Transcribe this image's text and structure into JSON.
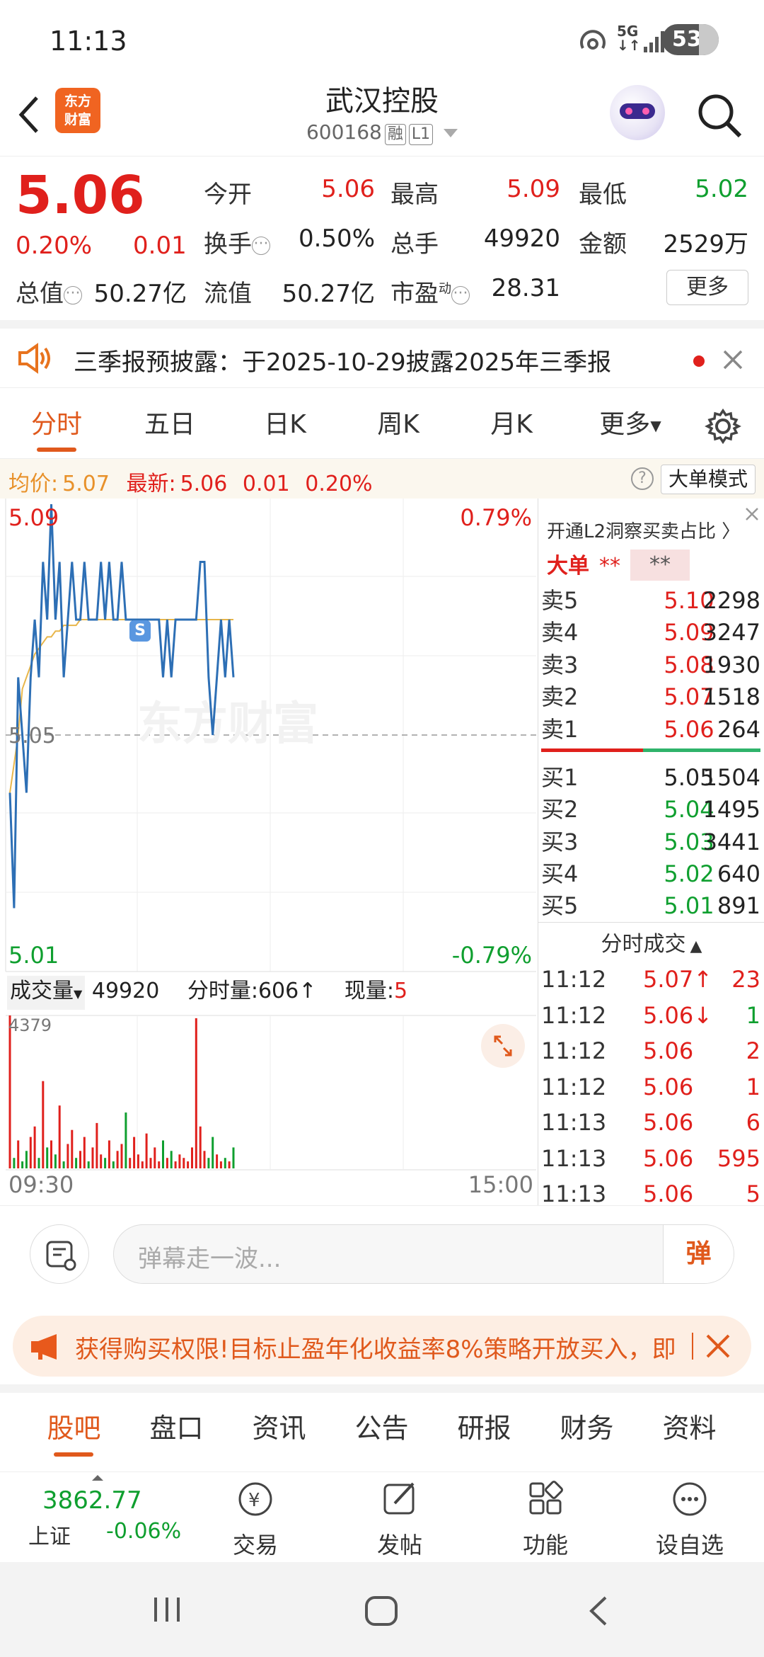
{
  "status": {
    "time": "11:13",
    "net": "5G",
    "battery": "53"
  },
  "header": {
    "title": "武汉控股",
    "code": "600168",
    "tag_margin": "融",
    "tag_level": "L1",
    "logo_line1": "东方",
    "logo_line2": "财富"
  },
  "quote": {
    "price": "5.06",
    "change_pct": "0.20%",
    "change": "0.01",
    "open_label": "今开",
    "open": "5.06",
    "high_label": "最高",
    "high": "5.09",
    "low_label": "最低",
    "low": "5.02",
    "turnover_label": "换手",
    "turnover": "0.50%",
    "volume_label": "总手",
    "volume": "49920",
    "amount_label": "金额",
    "amount": "2529万",
    "mktcap_label": "总值",
    "mktcap": "50.27亿",
    "float_label": "流值",
    "float": "50.27亿",
    "pe_label": "市盈",
    "pe_sup": "动",
    "pe": "28.31",
    "more": "更多"
  },
  "notice": {
    "text": "三季报预披露：于2025-10-29披露2025年三季报"
  },
  "tabs": [
    "分时",
    "五日",
    "日K",
    "周K",
    "月K",
    "更多"
  ],
  "infobar": {
    "avg_label": "均价:",
    "avg": "5.07",
    "last_label": "最新:",
    "last": "5.06",
    "chg": "0.01",
    "pct": "0.20%",
    "mode": "大单模式"
  },
  "chart": {
    "ymax": "5.09",
    "ymin": "5.01",
    "ymid": "5.05",
    "pmax": "0.79%",
    "pmin": "-0.79%",
    "watermark": "东方财富",
    "vol_label": "成交量",
    "vol_value": "49920",
    "fs_label": "分时量:606↑",
    "now_label": "现量:",
    "now_value": "5",
    "vol_max": "4379",
    "t_start": "09:30",
    "t_end": "15:00",
    "s_badge": "S"
  },
  "chart_data": {
    "type": "line",
    "ylim": [
      5.01,
      5.09
    ],
    "series": [
      {
        "name": "",
        "values": [
          5.04,
          5.02,
          5.06,
          5.05,
          5.04,
          5.06,
          5.07,
          5.06,
          5.08,
          5.07,
          5.09,
          5.07,
          5.08,
          5.06,
          5.07,
          5.08,
          5.07,
          5.07,
          5.08,
          5.07,
          5.07,
          5.07,
          5.08,
          5.07,
          5.08,
          5.07,
          5.07,
          5.08,
          5.07,
          5.07,
          5.07,
          5.07,
          5.07,
          5.07,
          5.07,
          5.07,
          5.07,
          5.06,
          5.07,
          5.06,
          5.07,
          5.07,
          5.07,
          5.07,
          5.07,
          5.07,
          5.08,
          5.08,
          5.06,
          5.05,
          5.06,
          5.07,
          5.06,
          5.07,
          5.06
        ]
      },
      {
        "name": "均价",
        "values": [
          5.04,
          5.045,
          5.05,
          5.058,
          5.06,
          5.062,
          5.064,
          5.065,
          5.066,
          5.067,
          5.067,
          5.068,
          5.068,
          5.069,
          5.069,
          5.069,
          5.069,
          5.07,
          5.07,
          5.07,
          5.07,
          5.07,
          5.07,
          5.07,
          5.07,
          5.07,
          5.07,
          5.07,
          5.07,
          5.07,
          5.07,
          5.07,
          5.07,
          5.07,
          5.07,
          5.07,
          5.07,
          5.07,
          5.07,
          5.07,
          5.07,
          5.07,
          5.07,
          5.07,
          5.07,
          5.07,
          5.07,
          5.07,
          5.07,
          5.07,
          5.07,
          5.07,
          5.07,
          5.07,
          5.07
        ]
      }
    ],
    "volume": [
      4379,
      300,
      800,
      200,
      500,
      900,
      1200,
      300,
      2500,
      600,
      800,
      400,
      1800,
      200,
      700,
      1100,
      300,
      500,
      900,
      200,
      600,
      1300,
      400,
      300,
      800,
      200,
      500,
      700,
      1600,
      300,
      900,
      400,
      200,
      1000,
      300,
      600,
      200,
      800,
      300,
      500,
      200,
      400,
      300,
      200,
      600,
      4300,
      1200,
      500,
      300,
      900,
      400,
      200,
      300,
      200,
      600
    ]
  },
  "orderbook": {
    "header": "开通L2洞察买卖占比 〉",
    "big_label": "大单",
    "big_stars": "**",
    "big_stars2": "**",
    "asks": [
      {
        "l": "卖5",
        "p": "5.10",
        "v": "2298"
      },
      {
        "l": "卖4",
        "p": "5.09",
        "v": "3247"
      },
      {
        "l": "卖3",
        "p": "5.08",
        "v": "1930"
      },
      {
        "l": "卖2",
        "p": "5.07",
        "v": "1518"
      },
      {
        "l": "卖1",
        "p": "5.06",
        "v": "264"
      }
    ],
    "bids": [
      {
        "l": "买1",
        "p": "5.05",
        "v": "1504"
      },
      {
        "l": "买2",
        "p": "5.04",
        "v": "1495"
      },
      {
        "l": "买3",
        "p": "5.03",
        "v": "3441"
      },
      {
        "l": "买4",
        "p": "5.02",
        "v": "640"
      },
      {
        "l": "买5",
        "p": "5.01",
        "v": "891"
      }
    ],
    "ticks_title": "分时成交",
    "ticks": [
      {
        "t": "11:12",
        "p": "5.07↑",
        "v": "23"
      },
      {
        "t": "11:12",
        "p": "5.06↓",
        "v": "1"
      },
      {
        "t": "11:12",
        "p": "5.06",
        "v": "2"
      },
      {
        "t": "11:12",
        "p": "5.06",
        "v": "1"
      },
      {
        "t": "11:13",
        "p": "5.06",
        "v": "6"
      },
      {
        "t": "11:13",
        "p": "5.06",
        "v": "595"
      },
      {
        "t": "11:13",
        "p": "5.06",
        "v": "5"
      }
    ]
  },
  "comment": {
    "placeholder": "弹幕走一波...",
    "danmu": "弹"
  },
  "ad": {
    "text": "获得购买权限!目标止盈年化收益率8%策略开放买入，即"
  },
  "bottom_tabs": [
    "股吧",
    "盘口",
    "资讯",
    "公告",
    "研报",
    "财务",
    "资料"
  ],
  "footer": {
    "index_value": "3862.77",
    "index_name": "上证",
    "index_chg": "-0.06%",
    "trade": "交易",
    "post": "发帖",
    "func": "功能",
    "watch": "设自选"
  },
  "colors": {
    "up": "#e0201c",
    "down": "#0f9f2f",
    "accent": "#e0591c",
    "line": "#2d6fb5",
    "avg": "#e8b64a"
  }
}
